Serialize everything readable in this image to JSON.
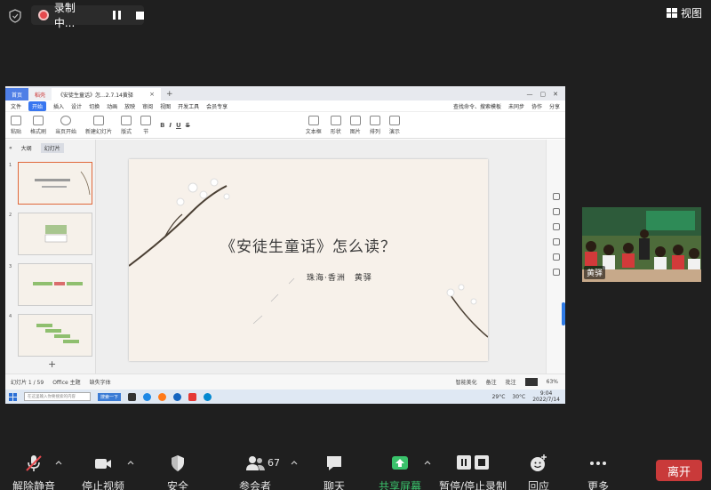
{
  "top": {
    "rec_label": "录制中...",
    "view_label": "视图"
  },
  "screen": {
    "tabs": [
      {
        "label": "首页"
      },
      {
        "label": "稻壳"
      },
      {
        "label": "《安徒生童话》怎...2.7.14黄驿"
      }
    ],
    "menu": [
      "文件",
      "开始",
      "插入",
      "设计",
      "切换",
      "动画",
      "放映",
      "审阅",
      "视图",
      "开发工具",
      "会员专享"
    ],
    "menu_right": [
      "查找命令、搜索模板",
      "未同步",
      "协作",
      "分享"
    ],
    "ribbon": [
      "粘贴",
      "格式刷",
      "当页开始",
      "新建幻灯片",
      "版式",
      "节",
      "文本框",
      "形状",
      "图片",
      "排列",
      "演示"
    ],
    "thumb_tabs": [
      "大纲",
      "幻灯片"
    ],
    "slide": {
      "title": "《安徒生童话》怎么读？",
      "author": "珠海·香洲　黄驿"
    },
    "status": {
      "page": "幻灯片 1 / 59",
      "theme": "Office 主题",
      "font": "缺失字体",
      "beautify": "智能美化",
      "notes": "备注",
      "comment": "批注",
      "zoom": "63%"
    },
    "taskbar": {
      "search_placeholder": "在这里输入你要搜索的内容",
      "search_btn": "搜索一下",
      "weather1": "29°C",
      "weather2": "30°C",
      "time": "9:04",
      "date": "2022/7/14"
    }
  },
  "video": {
    "name": "黄驿"
  },
  "toolbar": {
    "mute": "解除静音",
    "video": "停止视频",
    "security": "安全",
    "participants": "参会者",
    "participants_count": "67",
    "chat": "聊天",
    "share": "共享屏幕",
    "record": "暂停/停止录制",
    "reactions": "回应",
    "more": "更多",
    "leave": "离开"
  },
  "colors": {
    "accent_green": "#3ac26b",
    "leave_red": "#c93a3a",
    "wps_blue": "#3876f0"
  }
}
